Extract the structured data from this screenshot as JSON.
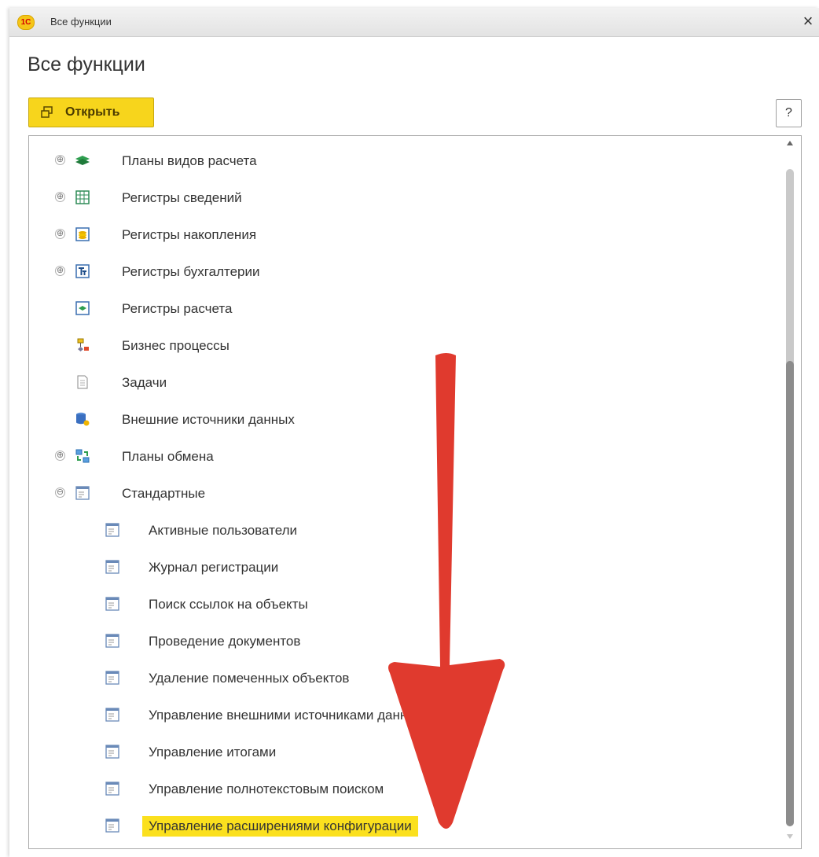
{
  "window": {
    "title": "Все функции",
    "app_logo_text": "1С",
    "close_glyph": "×"
  },
  "page": {
    "title": "Все функции"
  },
  "toolbar": {
    "open_label": "Открыть",
    "help_label": "?"
  },
  "tree": {
    "items": [
      {
        "label": "Планы видов расчета",
        "icon": "calc-types-plan-icon",
        "toggle": "⊕"
      },
      {
        "label": "Регистры сведений",
        "icon": "info-register-icon",
        "toggle": "⊕"
      },
      {
        "label": "Регистры накопления",
        "icon": "accumulation-register-icon",
        "toggle": "⊕"
      },
      {
        "label": "Регистры бухгалтерии",
        "icon": "accounting-register-icon",
        "toggle": "⊕"
      },
      {
        "label": "Регистры расчета",
        "icon": "calc-register-icon",
        "toggle": ""
      },
      {
        "label": "Бизнес процессы",
        "icon": "business-process-icon",
        "toggle": ""
      },
      {
        "label": "Задачи",
        "icon": "task-icon",
        "toggle": ""
      },
      {
        "label": "Внешние источники данных",
        "icon": "external-data-source-icon",
        "toggle": ""
      },
      {
        "label": "Планы обмена",
        "icon": "exchange-plan-icon",
        "toggle": "⊕"
      },
      {
        "label": "Стандартные",
        "icon": "form-icon",
        "toggle": "⊖"
      }
    ],
    "standard_items": [
      {
        "label": "Активные пользователи"
      },
      {
        "label": "Журнал регистрации"
      },
      {
        "label": "Поиск ссылок на объекты"
      },
      {
        "label": "Проведение документов"
      },
      {
        "label": "Удаление помеченных объектов"
      },
      {
        "label": "Управление внешними источниками данных"
      },
      {
        "label": "Управление итогами"
      },
      {
        "label": "Управление полнотекстовым поиском"
      },
      {
        "label": "Управление расширениями конфигурации",
        "highlighted": true
      }
    ]
  },
  "colors": {
    "accent": "#f7d51c",
    "highlight": "#fbe01e",
    "arrow": "#e03a2e"
  }
}
